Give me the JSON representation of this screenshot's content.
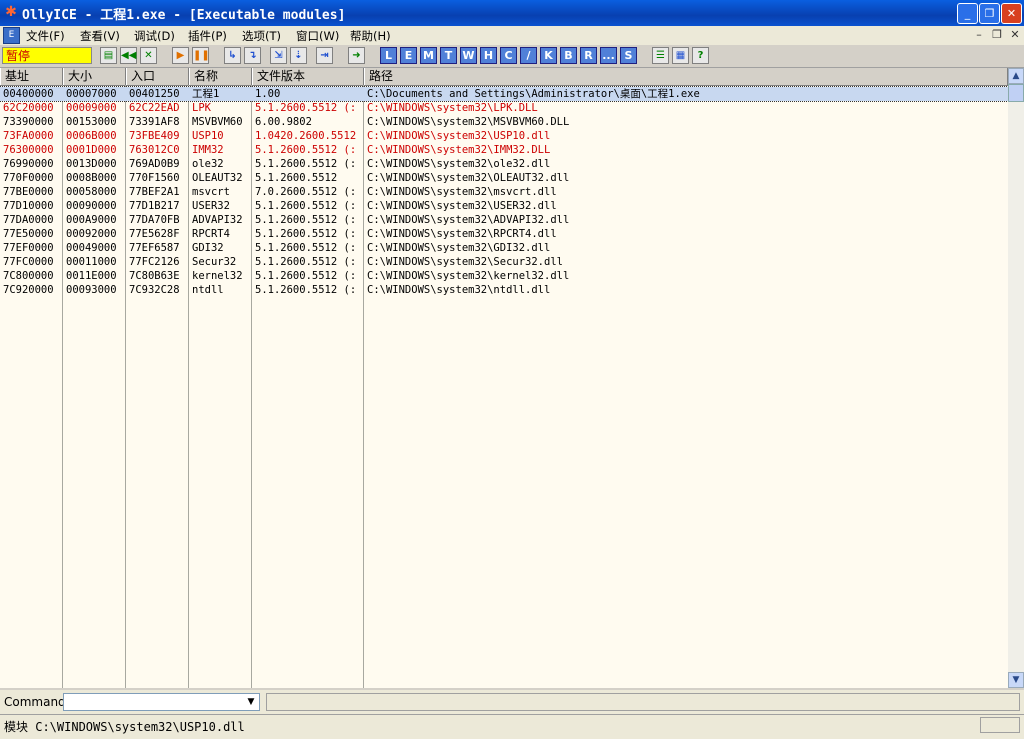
{
  "window": {
    "title": "OllyICE - 工程1.exe - [Executable modules]",
    "icon": "ollydbg-bug-icon",
    "controls": {
      "minimize": "_",
      "restore": "❐",
      "close": "✕"
    }
  },
  "menu": {
    "items": [
      "文件(F)",
      "查看(V)",
      "调试(D)",
      "插件(P)",
      "选项(T)",
      "窗口(W)",
      "帮助(H)"
    ],
    "mdi_controls": {
      "minimize": "–",
      "restore": "❐",
      "close": "✕"
    }
  },
  "toolbar": {
    "state": "暂停",
    "buttons": [
      "open",
      "restart",
      "close",
      "run",
      "pause",
      "step-into",
      "step-over",
      "trace-into",
      "trace-over",
      "execute-till-return",
      "goto-user-code"
    ],
    "window_letters": [
      "L",
      "E",
      "M",
      "T",
      "W",
      "H",
      "C",
      "/",
      "K",
      "B",
      "R",
      "...",
      "S"
    ],
    "extra_icons": [
      "list-icon",
      "options-icon",
      "help-icon"
    ]
  },
  "columns": [
    "基址",
    "大小",
    "入口",
    "名称",
    "文件版本",
    "路径"
  ],
  "modules": [
    {
      "base": "00400000",
      "size": "00007000",
      "entry": "00401250",
      "name": "工程1",
      "version": "1.00",
      "path": "C:\\Documents and Settings\\Administrator\\桌面\\工程1.exe",
      "highlight": false,
      "selected": true
    },
    {
      "base": "62C20000",
      "size": "00009000",
      "entry": "62C22EAD",
      "name": "LPK",
      "version": "5.1.2600.5512 (:",
      "path": "C:\\WINDOWS\\system32\\LPK.DLL",
      "highlight": true
    },
    {
      "base": "73390000",
      "size": "00153000",
      "entry": "73391AF8",
      "name": "MSVBVM60",
      "version": "6.00.9802",
      "path": "C:\\WINDOWS\\system32\\MSVBVM60.DLL",
      "highlight": false
    },
    {
      "base": "73FA0000",
      "size": "0006B000",
      "entry": "73FBE409",
      "name": "USP10",
      "version": "1.0420.2600.5512",
      "path": "C:\\WINDOWS\\system32\\USP10.dll",
      "highlight": true
    },
    {
      "base": "76300000",
      "size": "0001D000",
      "entry": "763012C0",
      "name": "IMM32",
      "version": "5.1.2600.5512 (:",
      "path": "C:\\WINDOWS\\system32\\IMM32.DLL",
      "highlight": true
    },
    {
      "base": "76990000",
      "size": "0013D000",
      "entry": "769AD0B9",
      "name": "ole32",
      "version": "5.1.2600.5512 (:",
      "path": "C:\\WINDOWS\\system32\\ole32.dll",
      "highlight": false
    },
    {
      "base": "770F0000",
      "size": "0008B000",
      "entry": "770F1560",
      "name": "OLEAUT32",
      "version": "5.1.2600.5512",
      "path": "C:\\WINDOWS\\system32\\OLEAUT32.dll",
      "highlight": false
    },
    {
      "base": "77BE0000",
      "size": "00058000",
      "entry": "77BEF2A1",
      "name": "msvcrt",
      "version": "7.0.2600.5512 (:",
      "path": "C:\\WINDOWS\\system32\\msvcrt.dll",
      "highlight": false
    },
    {
      "base": "77D10000",
      "size": "00090000",
      "entry": "77D1B217",
      "name": "USER32",
      "version": "5.1.2600.5512 (:",
      "path": "C:\\WINDOWS\\system32\\USER32.dll",
      "highlight": false
    },
    {
      "base": "77DA0000",
      "size": "000A9000",
      "entry": "77DA70FB",
      "name": "ADVAPI32",
      "version": "5.1.2600.5512 (:",
      "path": "C:\\WINDOWS\\system32\\ADVAPI32.dll",
      "highlight": false
    },
    {
      "base": "77E50000",
      "size": "00092000",
      "entry": "77E5628F",
      "name": "RPCRT4",
      "version": "5.1.2600.5512 (:",
      "path": "C:\\WINDOWS\\system32\\RPCRT4.dll",
      "highlight": false
    },
    {
      "base": "77EF0000",
      "size": "00049000",
      "entry": "77EF6587",
      "name": "GDI32",
      "version": "5.1.2600.5512 (:",
      "path": "C:\\WINDOWS\\system32\\GDI32.dll",
      "highlight": false
    },
    {
      "base": "77FC0000",
      "size": "00011000",
      "entry": "77FC2126",
      "name": "Secur32",
      "version": "5.1.2600.5512 (:",
      "path": "C:\\WINDOWS\\system32\\Secur32.dll",
      "highlight": false
    },
    {
      "base": "7C800000",
      "size": "0011E000",
      "entry": "7C80B63E",
      "name": "kernel32",
      "version": "5.1.2600.5512 (:",
      "path": "C:\\WINDOWS\\system32\\kernel32.dll",
      "highlight": false
    },
    {
      "base": "7C920000",
      "size": "00093000",
      "entry": "7C932C28",
      "name": "ntdll",
      "version": "5.1.2600.5512 (:",
      "path": "C:\\WINDOWS\\system32\\ntdll.dll",
      "highlight": false
    }
  ],
  "command": {
    "label": "Command",
    "value": ""
  },
  "status": {
    "text": "模块 C:\\WINDOWS\\system32\\USP10.dll"
  },
  "colors": {
    "highlight": "#cc0000",
    "selection": "#c8d8f0",
    "list_background": "#fffbf0"
  }
}
